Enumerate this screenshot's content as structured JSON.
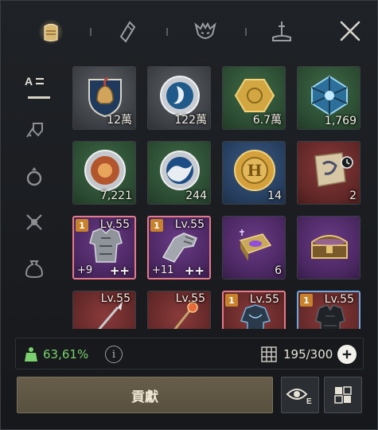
{
  "tabs": [
    {
      "name": "backpack-icon",
      "active": true
    },
    {
      "name": "crystal-icon",
      "active": false
    },
    {
      "name": "demon-mask-icon",
      "active": false
    },
    {
      "name": "sword-altar-icon",
      "active": false
    }
  ],
  "rail": [
    {
      "name": "sort-icon"
    },
    {
      "name": "weapon-armor-icon"
    },
    {
      "name": "ring-icon"
    },
    {
      "name": "tools-icon"
    },
    {
      "name": "bag-icon"
    }
  ],
  "items": [
    {
      "name": "spartan-helmet-shield",
      "rarity": "gray",
      "qty": "12萬"
    },
    {
      "name": "moon-coin",
      "rarity": "gray",
      "qty": "122萬"
    },
    {
      "name": "gold-hex-coin",
      "rarity": "green",
      "qty": "6.7萬"
    },
    {
      "name": "blue-crystal-cage",
      "rarity": "green",
      "qty": "1,769"
    },
    {
      "name": "sun-medallion",
      "rarity": "green",
      "qty": "7,221"
    },
    {
      "name": "wave-coin",
      "rarity": "green",
      "qty": "244"
    },
    {
      "name": "h-gold-coin",
      "rarity": "blue",
      "qty": "14"
    },
    {
      "name": "scroll-with-clock",
      "rarity": "red",
      "qty": "2"
    },
    {
      "name": "plate-armor",
      "rarity": "purple",
      "badge": "1",
      "level": "Lv.55",
      "enhance": "+9",
      "plus": "++",
      "border": "red"
    },
    {
      "name": "gauntlets",
      "rarity": "purple",
      "badge": "1",
      "level": "Lv.55",
      "enhance": "+11",
      "plus": "++",
      "border": "red"
    },
    {
      "name": "purple-tome",
      "rarity": "purple",
      "qty": "6"
    },
    {
      "name": "treasure-chest",
      "rarity": "purple"
    },
    {
      "name": "spear",
      "rarity": "red",
      "level": "Lv.55"
    },
    {
      "name": "staff",
      "rarity": "red",
      "level": "Lv.55"
    },
    {
      "name": "dark-robe",
      "rarity": "red",
      "badge": "1",
      "level": "Lv.55",
      "border": "red"
    },
    {
      "name": "dark-armor",
      "rarity": "red",
      "badge": "1",
      "level": "Lv.55",
      "border": "blue"
    }
  ],
  "status": {
    "weight": "63,61%",
    "info": "i",
    "slots": "195/300"
  },
  "buttons": {
    "contribute": "貢獻"
  },
  "colors": {
    "weight_green": "#7ad06e",
    "contribute_bg": "#5f5645"
  }
}
